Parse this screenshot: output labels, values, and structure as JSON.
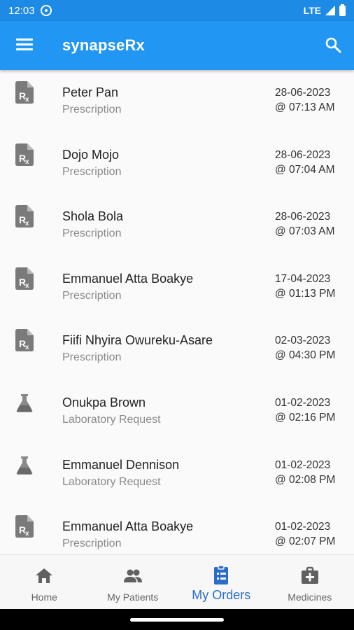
{
  "status_bar": {
    "time": "12:03",
    "network": "LTE"
  },
  "app_bar": {
    "title": "synapseRx",
    "menu_icon": "menu-icon",
    "search_icon": "search-icon"
  },
  "orders": [
    {
      "name": "Peter Pan",
      "type": "Prescription",
      "date": "28-06-2023",
      "time": "@ 07:13 AM",
      "icon": "prescription-icon"
    },
    {
      "name": "Dojo Mojo",
      "type": "Prescription",
      "date": "28-06-2023",
      "time": "@ 07:04 AM",
      "icon": "prescription-icon"
    },
    {
      "name": "Shola Bola",
      "type": "Prescription",
      "date": "28-06-2023",
      "time": "@ 07:03 AM",
      "icon": "prescription-icon"
    },
    {
      "name": "Emmanuel Atta Boakye",
      "type": "Prescription",
      "date": "17-04-2023",
      "time": "@ 01:13 PM",
      "icon": "prescription-icon"
    },
    {
      "name": "Fiifi Nhyira Owureku-Asare",
      "type": "Prescription",
      "date": "02-03-2023",
      "time": "@ 04:30 PM",
      "icon": "prescription-icon"
    },
    {
      "name": "Onukpa Brown",
      "type": "Laboratory Request",
      "date": "01-02-2023",
      "time": "@ 02:16 PM",
      "icon": "flask-icon"
    },
    {
      "name": "Emmanuel Dennison",
      "type": "Laboratory Request",
      "date": "01-02-2023",
      "time": "@ 02:08 PM",
      "icon": "flask-icon"
    },
    {
      "name": "Emmanuel Atta Boakye",
      "type": "Prescription",
      "date": "01-02-2023",
      "time": "@ 02:07 PM",
      "icon": "prescription-icon"
    }
  ],
  "bottom_nav": [
    {
      "label": "Home",
      "icon": "home-icon",
      "active": false
    },
    {
      "label": "My Patients",
      "icon": "people-icon",
      "active": false
    },
    {
      "label": "My Orders",
      "icon": "clipboard-list-icon",
      "active": true
    },
    {
      "label": "Medicines",
      "icon": "medical-bag-icon",
      "active": false
    }
  ],
  "colors": {
    "status_bar": "#1d8ae6",
    "app_bar": "#2196f3",
    "active_nav": "#2a6ec9",
    "icon_gray": "#7a7a7a"
  }
}
